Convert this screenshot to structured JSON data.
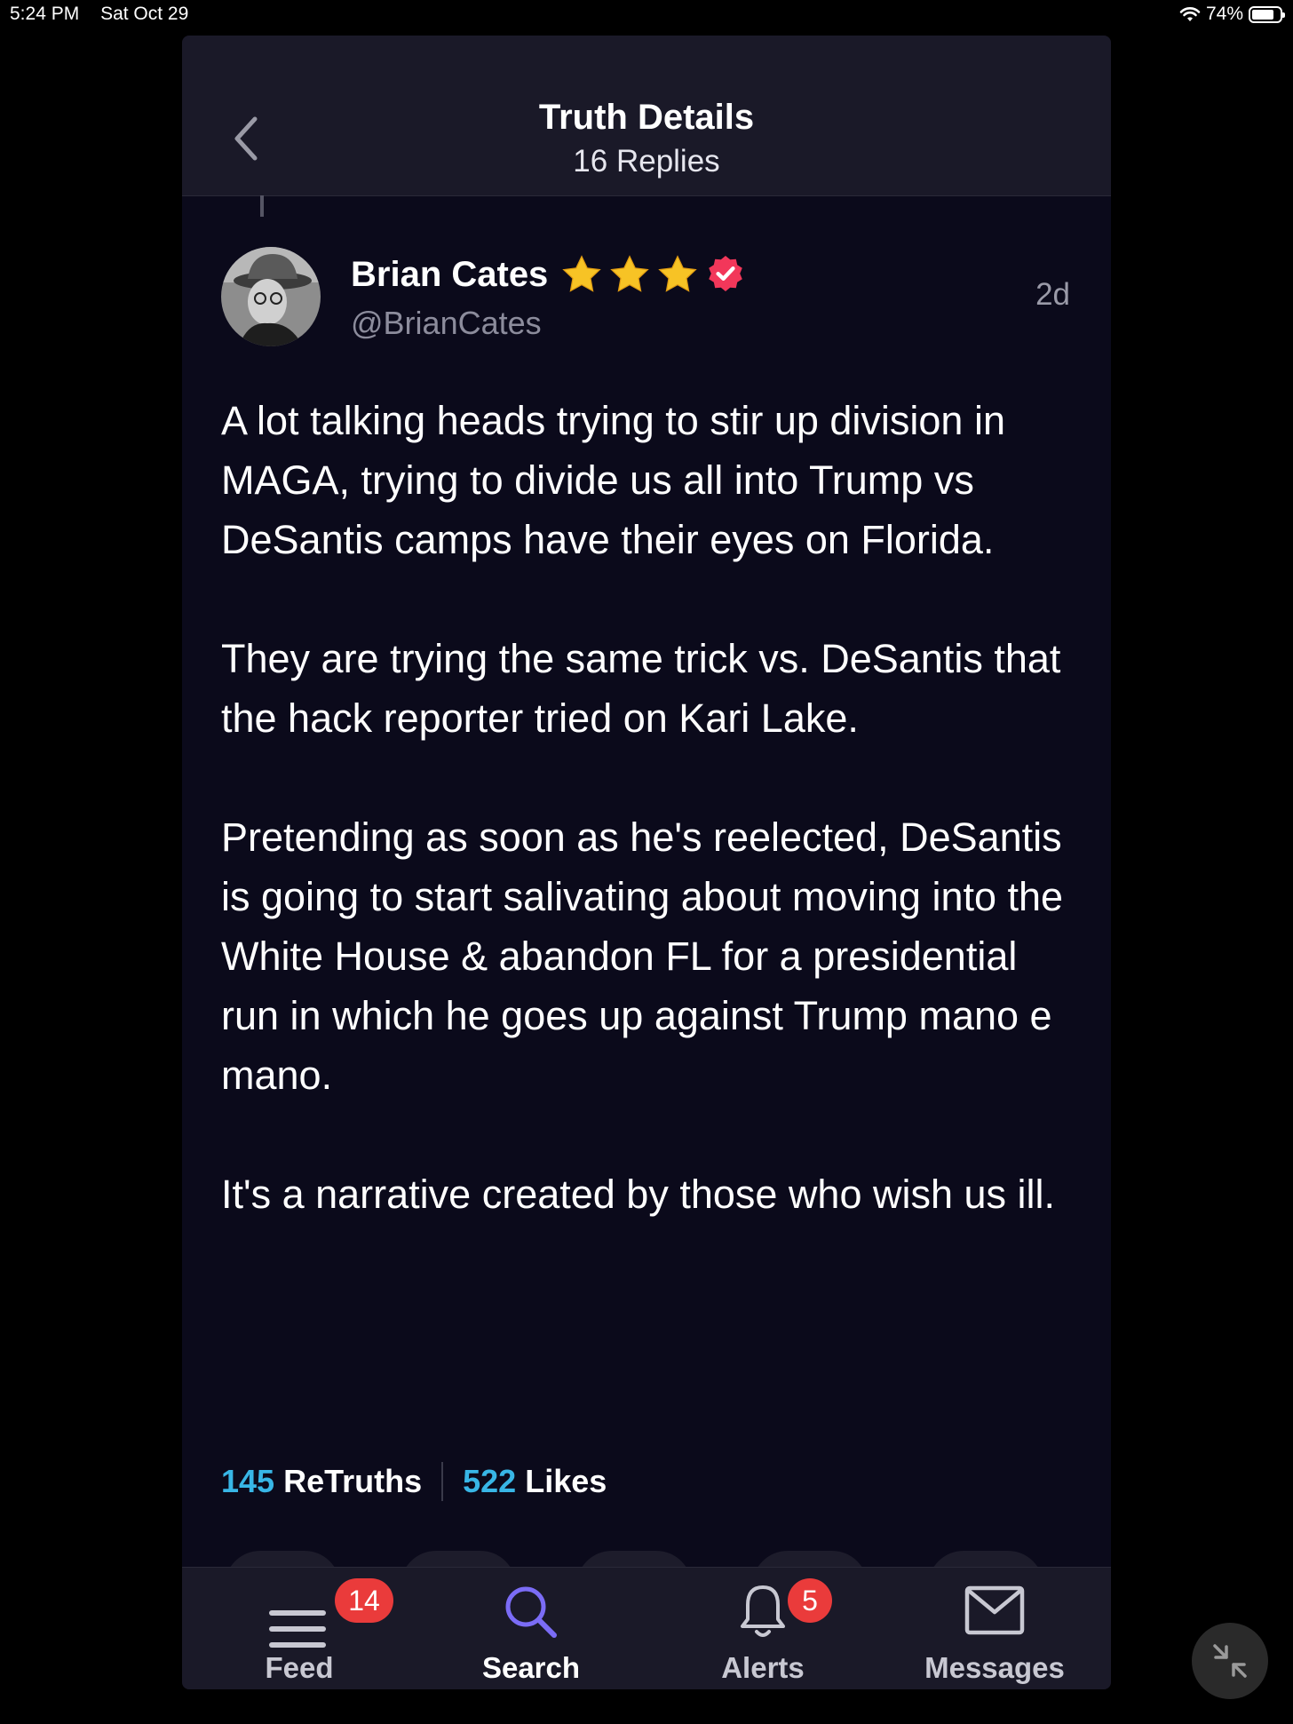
{
  "status_bar": {
    "time": "5:24 PM",
    "date": "Sat Oct 29",
    "battery": "74%",
    "battery_level": 0.74
  },
  "header": {
    "title": "Truth Details",
    "subtitle": "16 Replies",
    "back_icon": "chevron-left-icon"
  },
  "post": {
    "author_name": "Brian Cates",
    "handle": "@BrianCates",
    "time": "2d",
    "stars": 3,
    "verified_icon": "verified-badge-icon",
    "paragraphs": [
      "A lot talking heads trying to stir up division in MAGA, trying to divide us all into Trump vs DeSantis camps have their eyes on Florida.",
      "They are trying the same trick vs. DeSantis that the hack reporter tried on Kari Lake.",
      "Pretending as soon as he's reelected, DeSantis is going to start salivating about moving into the White House & abandon FL for a presidential run in which he goes up against Trump mano e mano.",
      "It's a narrative created by those who wish us ill."
    ],
    "retruths_count": "145",
    "retruths_label": "ReTruths",
    "likes_count": "522",
    "likes_label": "Likes"
  },
  "tabbar": {
    "feed_label": "Feed",
    "feed_badge": "14",
    "search_label": "Search",
    "alerts_label": "Alerts",
    "alerts_badge": "5",
    "messages_label": "Messages"
  },
  "colors": {
    "accent": "#38b6e6",
    "search_active": "#7b6cf6",
    "badge": "#ea3b3b",
    "background": "#0b0a1b"
  }
}
